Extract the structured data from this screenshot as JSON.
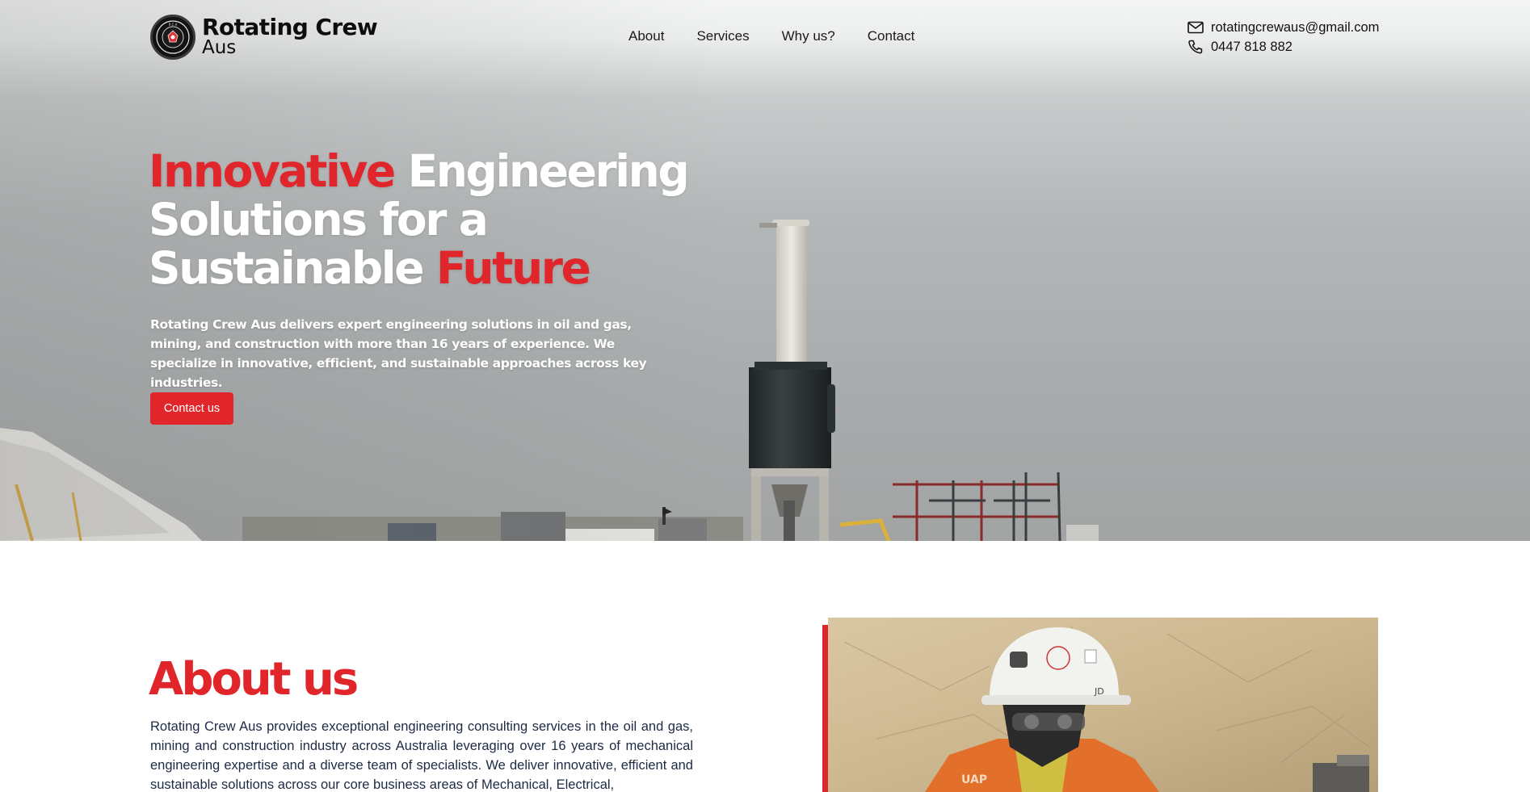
{
  "header": {
    "logo_line1": "Rotating Crew",
    "logo_line2": "Aus",
    "nav": [
      "About",
      "Services",
      "Why us?",
      "Contact"
    ],
    "email": "rotatingcrewaus@gmail.com",
    "phone": "0447 818 882",
    "icons": {
      "email": "mail-icon",
      "phone": "phone-icon",
      "logo": "crew-badge-logo"
    }
  },
  "hero": {
    "title_parts": {
      "w1": "Innovative",
      "w2": " Engineering",
      "line2": "Solutions for a",
      "w3": "Sustainable ",
      "w4": "Future"
    },
    "description": "Rotating Crew Aus delivers expert engineering solutions in oil and gas, mining, and construction with more than 16 years of experience. We specialize in innovative, efficient, and sustainable approaches across key industries.",
    "cta": "Contact us"
  },
  "about": {
    "title": "About us",
    "text": "Rotating Crew Aus provides exceptional engineering consulting services in the oil and gas, mining and construction industry across Australia leveraging over 16 years of mechanical engineering expertise and a diverse team of specialists. We deliver innovative, efficient and sustainable solutions across our core business areas of Mechanical, Electrical,"
  },
  "colors": {
    "accent": "#e0262b",
    "body_text": "#1d2a44"
  }
}
